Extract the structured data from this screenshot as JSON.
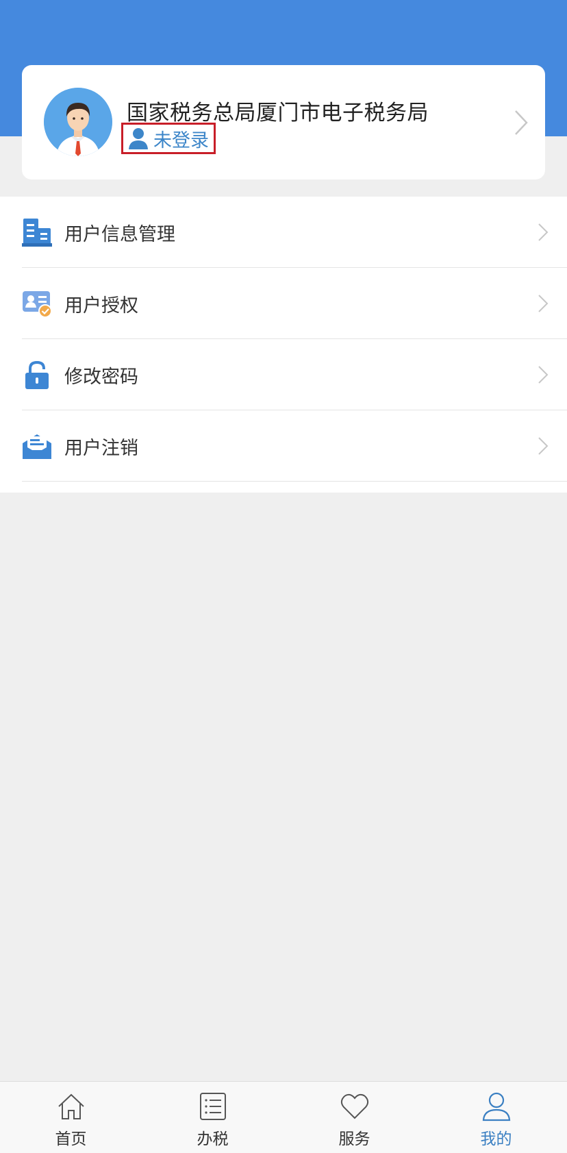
{
  "profile": {
    "title": "国家税务总局厦门市电子税务局",
    "login_status": "未登录"
  },
  "menu": {
    "items": [
      {
        "label": "用户信息管理",
        "icon": "building-icon"
      },
      {
        "label": "用户授权",
        "icon": "user-authorize-icon"
      },
      {
        "label": "修改密码",
        "icon": "lock-icon"
      },
      {
        "label": "用户注销",
        "icon": "mail-icon"
      }
    ]
  },
  "tabbar": {
    "tabs": [
      {
        "label": "首页",
        "icon": "home-icon"
      },
      {
        "label": "办税",
        "icon": "list-icon"
      },
      {
        "label": "服务",
        "icon": "heart-icon"
      },
      {
        "label": "我的",
        "icon": "person-icon",
        "active": true
      }
    ]
  },
  "colors": {
    "header_blue": "#4589de",
    "accent_blue": "#3a7fc2",
    "highlight_red": "#c81e28"
  }
}
